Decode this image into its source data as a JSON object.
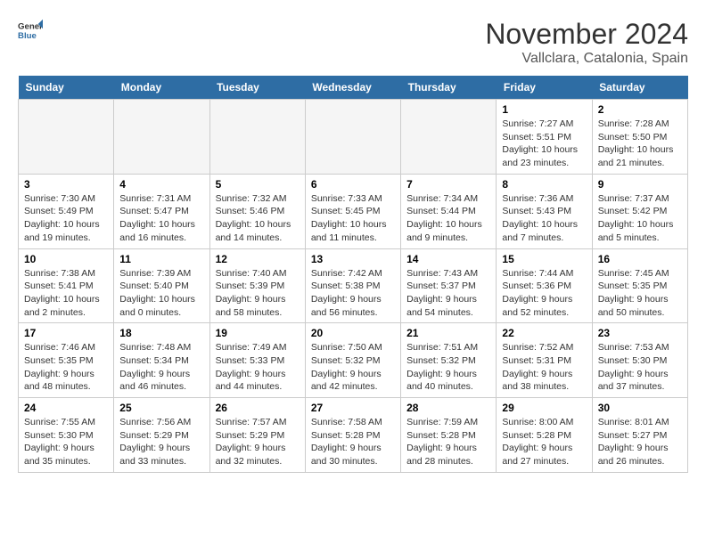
{
  "logo": {
    "general": "General",
    "blue": "Blue"
  },
  "header": {
    "month": "November 2024",
    "location": "Vallclara, Catalonia, Spain"
  },
  "weekdays": [
    "Sunday",
    "Monday",
    "Tuesday",
    "Wednesday",
    "Thursday",
    "Friday",
    "Saturday"
  ],
  "weeks": [
    [
      {
        "day": "",
        "detail": ""
      },
      {
        "day": "",
        "detail": ""
      },
      {
        "day": "",
        "detail": ""
      },
      {
        "day": "",
        "detail": ""
      },
      {
        "day": "",
        "detail": ""
      },
      {
        "day": "1",
        "detail": "Sunrise: 7:27 AM\nSunset: 5:51 PM\nDaylight: 10 hours and 23 minutes."
      },
      {
        "day": "2",
        "detail": "Sunrise: 7:28 AM\nSunset: 5:50 PM\nDaylight: 10 hours and 21 minutes."
      }
    ],
    [
      {
        "day": "3",
        "detail": "Sunrise: 7:30 AM\nSunset: 5:49 PM\nDaylight: 10 hours and 19 minutes."
      },
      {
        "day": "4",
        "detail": "Sunrise: 7:31 AM\nSunset: 5:47 PM\nDaylight: 10 hours and 16 minutes."
      },
      {
        "day": "5",
        "detail": "Sunrise: 7:32 AM\nSunset: 5:46 PM\nDaylight: 10 hours and 14 minutes."
      },
      {
        "day": "6",
        "detail": "Sunrise: 7:33 AM\nSunset: 5:45 PM\nDaylight: 10 hours and 11 minutes."
      },
      {
        "day": "7",
        "detail": "Sunrise: 7:34 AM\nSunset: 5:44 PM\nDaylight: 10 hours and 9 minutes."
      },
      {
        "day": "8",
        "detail": "Sunrise: 7:36 AM\nSunset: 5:43 PM\nDaylight: 10 hours and 7 minutes."
      },
      {
        "day": "9",
        "detail": "Sunrise: 7:37 AM\nSunset: 5:42 PM\nDaylight: 10 hours and 5 minutes."
      }
    ],
    [
      {
        "day": "10",
        "detail": "Sunrise: 7:38 AM\nSunset: 5:41 PM\nDaylight: 10 hours and 2 minutes."
      },
      {
        "day": "11",
        "detail": "Sunrise: 7:39 AM\nSunset: 5:40 PM\nDaylight: 10 hours and 0 minutes."
      },
      {
        "day": "12",
        "detail": "Sunrise: 7:40 AM\nSunset: 5:39 PM\nDaylight: 9 hours and 58 minutes."
      },
      {
        "day": "13",
        "detail": "Sunrise: 7:42 AM\nSunset: 5:38 PM\nDaylight: 9 hours and 56 minutes."
      },
      {
        "day": "14",
        "detail": "Sunrise: 7:43 AM\nSunset: 5:37 PM\nDaylight: 9 hours and 54 minutes."
      },
      {
        "day": "15",
        "detail": "Sunrise: 7:44 AM\nSunset: 5:36 PM\nDaylight: 9 hours and 52 minutes."
      },
      {
        "day": "16",
        "detail": "Sunrise: 7:45 AM\nSunset: 5:35 PM\nDaylight: 9 hours and 50 minutes."
      }
    ],
    [
      {
        "day": "17",
        "detail": "Sunrise: 7:46 AM\nSunset: 5:35 PM\nDaylight: 9 hours and 48 minutes."
      },
      {
        "day": "18",
        "detail": "Sunrise: 7:48 AM\nSunset: 5:34 PM\nDaylight: 9 hours and 46 minutes."
      },
      {
        "day": "19",
        "detail": "Sunrise: 7:49 AM\nSunset: 5:33 PM\nDaylight: 9 hours and 44 minutes."
      },
      {
        "day": "20",
        "detail": "Sunrise: 7:50 AM\nSunset: 5:32 PM\nDaylight: 9 hours and 42 minutes."
      },
      {
        "day": "21",
        "detail": "Sunrise: 7:51 AM\nSunset: 5:32 PM\nDaylight: 9 hours and 40 minutes."
      },
      {
        "day": "22",
        "detail": "Sunrise: 7:52 AM\nSunset: 5:31 PM\nDaylight: 9 hours and 38 minutes."
      },
      {
        "day": "23",
        "detail": "Sunrise: 7:53 AM\nSunset: 5:30 PM\nDaylight: 9 hours and 37 minutes."
      }
    ],
    [
      {
        "day": "24",
        "detail": "Sunrise: 7:55 AM\nSunset: 5:30 PM\nDaylight: 9 hours and 35 minutes."
      },
      {
        "day": "25",
        "detail": "Sunrise: 7:56 AM\nSunset: 5:29 PM\nDaylight: 9 hours and 33 minutes."
      },
      {
        "day": "26",
        "detail": "Sunrise: 7:57 AM\nSunset: 5:29 PM\nDaylight: 9 hours and 32 minutes."
      },
      {
        "day": "27",
        "detail": "Sunrise: 7:58 AM\nSunset: 5:28 PM\nDaylight: 9 hours and 30 minutes."
      },
      {
        "day": "28",
        "detail": "Sunrise: 7:59 AM\nSunset: 5:28 PM\nDaylight: 9 hours and 28 minutes."
      },
      {
        "day": "29",
        "detail": "Sunrise: 8:00 AM\nSunset: 5:28 PM\nDaylight: 9 hours and 27 minutes."
      },
      {
        "day": "30",
        "detail": "Sunrise: 8:01 AM\nSunset: 5:27 PM\nDaylight: 9 hours and 26 minutes."
      }
    ]
  ]
}
